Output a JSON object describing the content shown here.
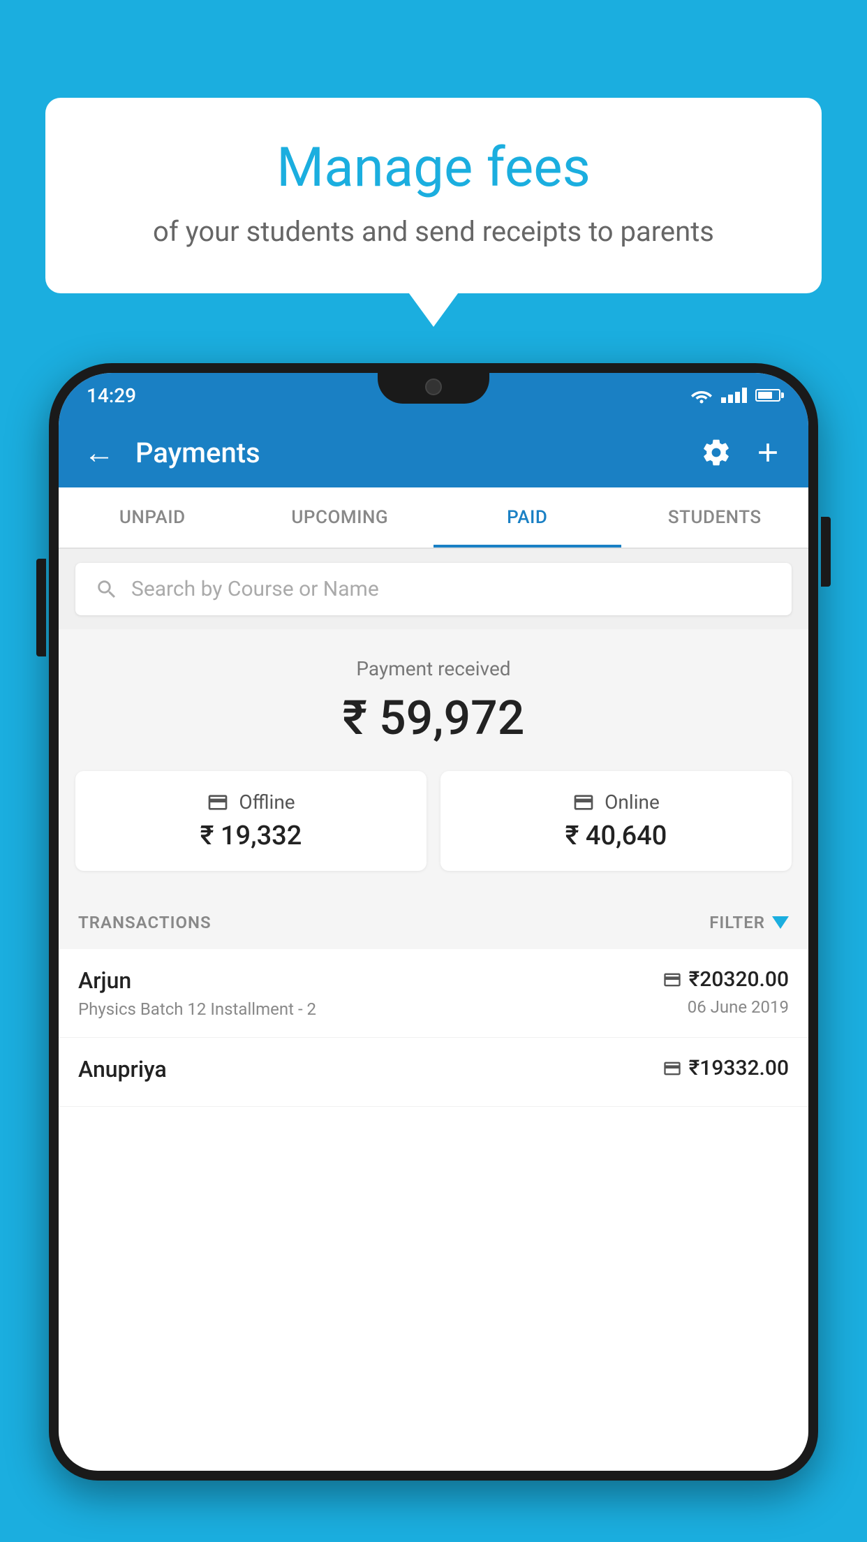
{
  "background_color": "#1BAEDF",
  "bubble": {
    "title": "Manage fees",
    "subtitle": "of your students and send receipts to parents"
  },
  "status_bar": {
    "time": "14:29"
  },
  "app_bar": {
    "title": "Payments"
  },
  "tabs": [
    {
      "label": "UNPAID",
      "active": false
    },
    {
      "label": "UPCOMING",
      "active": false
    },
    {
      "label": "PAID",
      "active": true
    },
    {
      "label": "STUDENTS",
      "active": false
    }
  ],
  "search": {
    "placeholder": "Search by Course or Name"
  },
  "payment": {
    "label": "Payment received",
    "total": "₹ 59,972",
    "offline": {
      "type": "Offline",
      "amount": "₹ 19,332"
    },
    "online": {
      "type": "Online",
      "amount": "₹ 40,640"
    }
  },
  "transactions_label": "TRANSACTIONS",
  "filter_label": "FILTER",
  "transactions": [
    {
      "name": "Arjun",
      "description": "Physics Batch 12 Installment - 2",
      "amount": "₹20320.00",
      "date": "06 June 2019",
      "icon_type": "card"
    },
    {
      "name": "Anupriya",
      "description": "",
      "amount": "₹19332.00",
      "date": "",
      "icon_type": "cash"
    }
  ]
}
